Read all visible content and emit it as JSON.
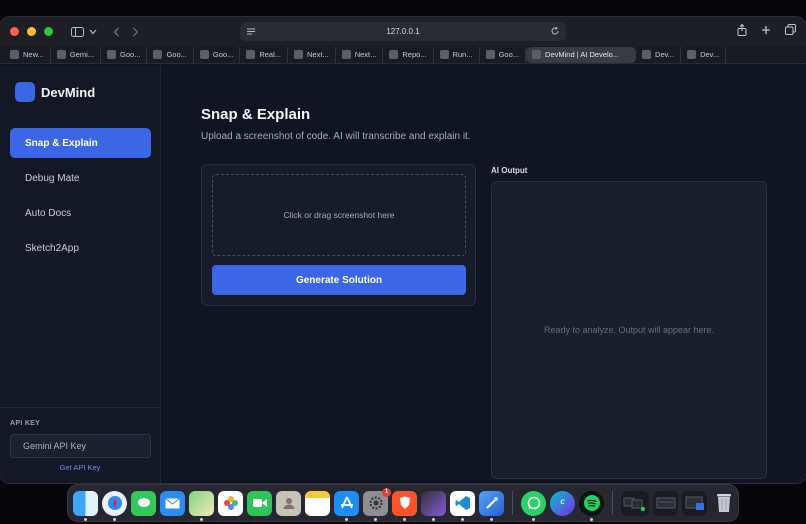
{
  "browser": {
    "url": "127.0.0.1",
    "tabs": [
      {
        "label": "New..."
      },
      {
        "label": "Gemi..."
      },
      {
        "label": "Goo..."
      },
      {
        "label": "Goo..."
      },
      {
        "label": "Goo..."
      },
      {
        "label": "Real..."
      },
      {
        "label": "Next..."
      },
      {
        "label": "Next..."
      },
      {
        "label": "Repo..."
      },
      {
        "label": "Run..."
      },
      {
        "label": "Goo..."
      },
      {
        "label": "DevMind | AI Develo...",
        "active": true
      },
      {
        "label": "Dev..."
      },
      {
        "label": "Dev..."
      }
    ]
  },
  "sidebar": {
    "brand": "DevMind",
    "items": [
      {
        "label": "Snap & Explain",
        "active": true
      },
      {
        "label": "Debug Mate"
      },
      {
        "label": "Auto Docs"
      },
      {
        "label": "Sketch2App"
      }
    ],
    "api_key_label": "API KEY",
    "api_key_placeholder": "Gemini API Key",
    "api_key_link": "Get API Key"
  },
  "main": {
    "title": "Snap & Explain",
    "subtitle": "Upload a screenshot of code. AI will transcribe and explain it.",
    "dropzone_text": "Click or drag screenshot here",
    "generate_button": "Generate Solution",
    "output_label": "AI Output",
    "output_placeholder": "Ready to analyze. Output will appear here."
  },
  "dock": {
    "notification_badge": "1",
    "apps": [
      "finder-icon",
      "safari-icon",
      "messages-icon",
      "mail-icon",
      "maps-icon",
      "photos-icon",
      "facetime-icon",
      "contacts-icon",
      "notes-icon",
      "app-store-icon",
      "system-settings-icon",
      "brave-icon",
      "final-cut-icon",
      "vscode-icon",
      "xcode-icon",
      "whatsapp-icon",
      "canva-icon",
      "spotify-icon"
    ]
  },
  "colors": {
    "accent": "#3b66e6",
    "app_bg": "#101423",
    "sidebar_bg": "#141826",
    "panel_bg": "#1a1f2e"
  }
}
